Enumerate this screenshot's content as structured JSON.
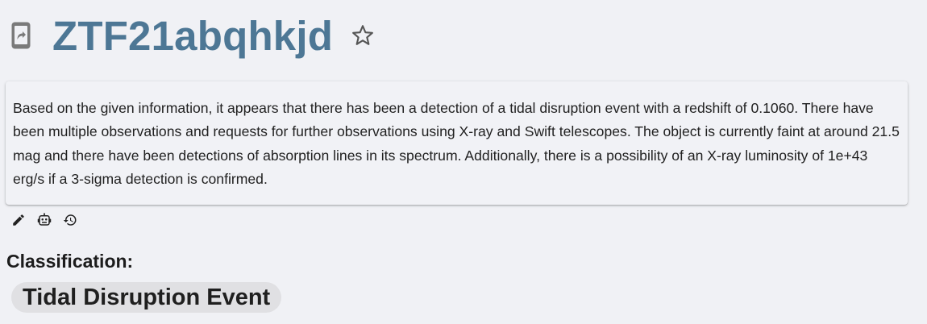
{
  "header": {
    "title": "ZTF21abqhkjd",
    "icons": [
      "device-share-icon",
      "star-outline-icon"
    ]
  },
  "summary": {
    "text": "Based on the given information, it appears that there has been a detection of a tidal disruption event with a redshift of 0.1060. There have been multiple observations and requests for further observations using X-ray and Swift telescopes. The object is currently faint at around 21.5 mag and there have been detections of absorption lines in its spectrum. Additionally, there is a possibility of an X-ray luminosity of 1e+43 erg/s if a 3-sigma detection is confirmed."
  },
  "actions": {
    "icons": [
      "pencil-icon",
      "robot-icon",
      "history-icon"
    ]
  },
  "classification": {
    "label": "Classification:",
    "value": "Tidal Disruption Event"
  },
  "colors": {
    "title": "#4d7795",
    "background": "#f0f1f5",
    "chip_background": "#e0e0e3"
  }
}
